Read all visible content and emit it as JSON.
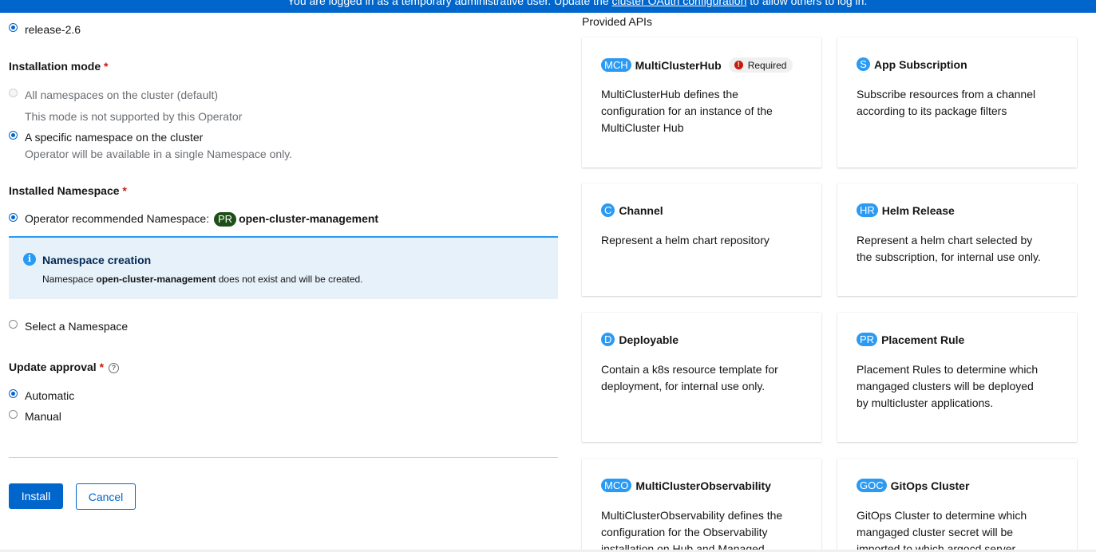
{
  "banner": {
    "text_before": "You are logged in as a temporary administrative user. Update the ",
    "link": "cluster OAuth configuration",
    "text_after": " to allow others to log in."
  },
  "channel": {
    "selected": "release-2.6"
  },
  "installation_mode": {
    "label": "Installation mode",
    "required_mark": "*",
    "options": [
      {
        "label": "All namespaces on the cluster (default)",
        "helper": "This mode is not supported by this Operator",
        "disabled": true,
        "checked": false
      },
      {
        "label": "A specific namespace on the cluster",
        "helper": "Operator will be available in a single Namespace only.",
        "disabled": false,
        "checked": true
      }
    ]
  },
  "installed_namespace": {
    "label": "Installed Namespace",
    "required_mark": "*",
    "recommended_label": "Operator recommended Namespace:",
    "badge": "PR",
    "namespace": "open-cluster-management",
    "alert": {
      "title": "Namespace creation",
      "icon": "info-icon",
      "body_before": "Namespace ",
      "body_bold": "open-cluster-management",
      "body_after": " does not exist and will be created."
    },
    "select_label": "Select a Namespace"
  },
  "update_approval": {
    "label": "Update approval",
    "required_mark": "*",
    "help_icon": "question-circle-icon",
    "options": [
      {
        "label": "Automatic",
        "checked": true
      },
      {
        "label": "Manual",
        "checked": false
      }
    ]
  },
  "actions": {
    "install": "Install",
    "cancel": "Cancel"
  },
  "provided_apis": {
    "heading": "Provided APIs",
    "required_label": "Required",
    "cards": [
      {
        "badge": "MCH",
        "name": "MultiClusterHub",
        "required": true,
        "description": "MultiClusterHub defines the configuration for an instance of the MultiCluster Hub"
      },
      {
        "badge": "S",
        "name": "App Subscription",
        "required": false,
        "description": "Subscribe resources from a channel according to its package filters"
      },
      {
        "badge": "C",
        "name": "Channel",
        "required": false,
        "description": "Represent a helm chart repository"
      },
      {
        "badge": "HR",
        "name": "Helm Release",
        "required": false,
        "description": "Represent a helm chart selected by the subscription, for internal use only."
      },
      {
        "badge": "D",
        "name": "Deployable",
        "required": false,
        "description": "Contain a k8s resource template for deployment, for internal use only."
      },
      {
        "badge": "PR",
        "name": "Placement Rule",
        "required": false,
        "description": "Placement Rules to determine which mangaged clusters will be deployed by multicluster applications."
      },
      {
        "badge": "MCO",
        "name": "MultiClusterObservability",
        "required": false,
        "description": "MultiClusterObservability defines the configuration for the Observability installation on Hub and Managed"
      },
      {
        "badge": "GOC",
        "name": "GitOps Cluster",
        "required": false,
        "description": "GitOps Cluster to determine which mangaged cluster secret will be imported to which argocd server"
      }
    ]
  }
}
